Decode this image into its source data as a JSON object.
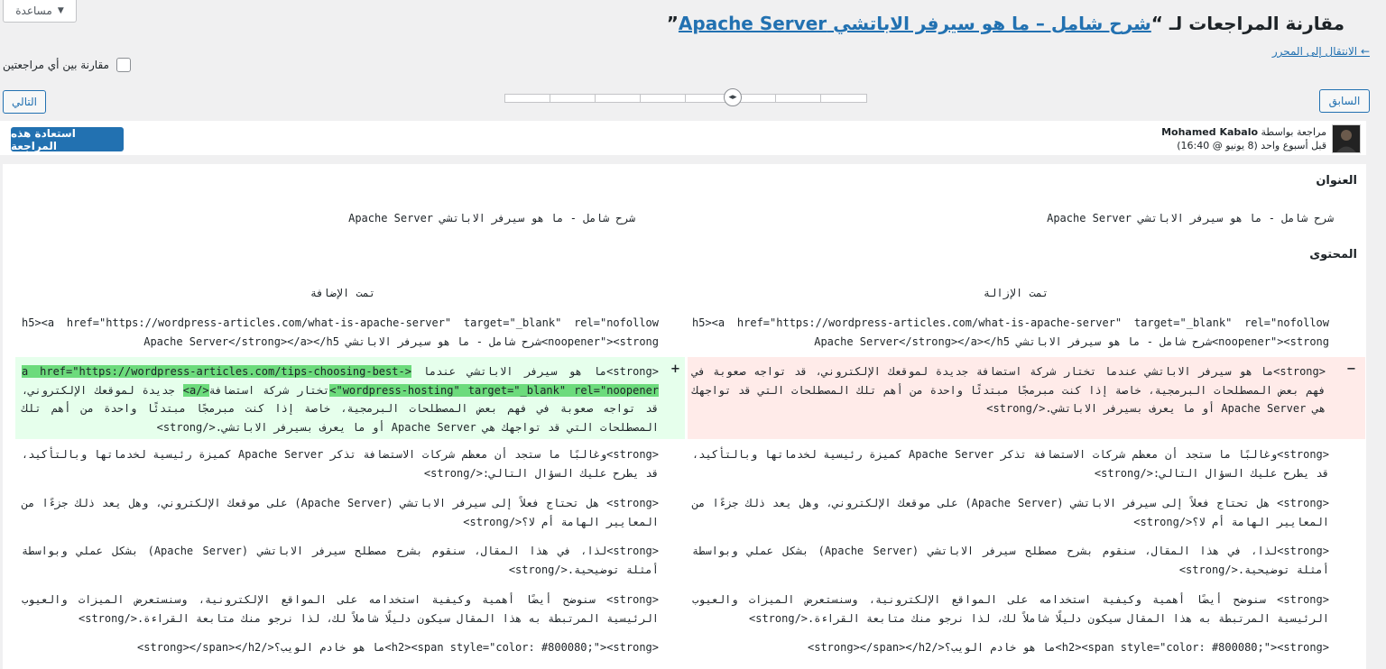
{
  "header": {
    "help_label": "مساعدة",
    "title_prefix": "مقارنة المراجعات لـ “",
    "title_link": "شرح شامل – ما هو سيرفر الاباتشي Apache Server",
    "title_suffix": "”",
    "editor_link": "← الانتقال إلى المحرر",
    "compare_any": "مقارنة بين أي مراجعتين"
  },
  "nav": {
    "next_label": "التالي",
    "prev_label": "السابق"
  },
  "meta": {
    "restore_label": "استعادة هذه المراجعة",
    "revision_by": "مراجعة بواسطة",
    "author": "Mohamed Kabalo",
    "when": "قبل أسبوع واحد (8 يونيو @ 16:40)"
  },
  "diff": {
    "title_label": "العنوان",
    "title_old": "شرح شامل - ما هو سيرفر الاباتشي Apache Server",
    "title_new": "شرح شامل - ما هو سيرفر الاباتشي Apache Server",
    "content_label": "المحتوى",
    "removed_head": "تمت الإزالة",
    "added_head": "تمت الإضافة",
    "rows": [
      {
        "left": "h5><a href=\"https://wordpress-articles.com/what-is-apache-server\" target=\"_blank\" rel=\"nofollow noopener\"><strong>شرح شامل - ما هو سيرفر الاباتشي Apache Server</strong></a></h5",
        "right": "h5><a href=\"https://wordpress-articles.com/what-is-apache-server\" target=\"_blank\" rel=\"nofollow noopener\"><strong>شرح شامل - ما هو سيرفر الاباتشي Apache Server</strong></a></h5"
      },
      {
        "removed_marker": "−",
        "added_marker": "+",
        "left_a": "<strong>ما هو سيرفر الاباتشي عندما ",
        "left_hl1": "<a href=\"https://wordpress-articles.com/tips-choosing-best-wordpress-hosting\" target=\"_blank\" rel=\"noopener\">",
        "left_b": "تختار شركة استضافة",
        "left_hl2": "</a>",
        "left_c": " جديدة لموقعك الإلكتروني، قد تواجه صعوبة في فهم بعض المصطلحات البرمجية، خاصة إذا كنت مبرمجًا مبتدئًا واحدة من أهم تلك المصطلحات التي قد تواجهك هي Apache Server أو ما يعرف بسيرفر الاباتشي.</strong>",
        "right": "<strong>ما هو سيرفر الاباتشي عندما تختار شركة استضافة جديدة لموقعك الإلكتروني، قد تواجه صعوبة في فهم بعض المصطلحات البرمجية، خاصة إذا كنت مبرمجًا مبتدئًا واحدة من أهم تلك المصطلحات التي قد تواجهك هي Apache Server أو ما يعرف بسيرفر الاباتشي.</strong>"
      },
      {
        "left": "<strong>وغالبًا ما ستجد أن معظم شركات الاستضافة تذكر Apache Server كميزة رئيسية لخدماتها وبالتأكيد، قد يطرح عليك السؤال التالي:</strong>",
        "right": "<strong>وغالبًا ما ستجد أن معظم شركات الاستضافة تذكر Apache Server كميزة رئيسية لخدماتها وبالتأكيد، قد يطرح عليك السؤال التالي:</strong>"
      },
      {
        "left": "<strong> هل تحتاج فعلاً إلى سيرفر الاباتشي (Apache Server) على موقعك الإلكتروني، وهل يعد ذلك جزءًا من المعايير الهامة أم لا؟</strong>",
        "right": "<strong> هل تحتاج فعلاً إلى سيرفر الاباتشي (Apache Server) على موقعك الإلكتروني، وهل يعد ذلك جزءًا من المعايير الهامة أم لا؟</strong>"
      },
      {
        "left": "<strong>لذا، في هذا المقال، سنقوم بشرح مصطلح سيرفر الاباتشي (Apache Server) بشكل عملي وبواسطة أمثلة توضيحية.</strong>",
        "right": "<strong>لذا، في هذا المقال، سنقوم بشرح مصطلح سيرفر الاباتشي (Apache Server) بشكل عملي وبواسطة أمثلة توضيحية.</strong>"
      },
      {
        "left": "<strong> سنوضح أيضًا أهمية وكيفية استخدامه على المواقع الإلكترونية، وسنستعرض الميزات والعيوب الرئيسية المرتبطة به هذا المقال سيكون دليلًا شاملاً لك، لذا نرجو منك متابعة القراءة.</strong>",
        "right": "<strong> سنوضح أيضًا أهمية وكيفية استخدامه على المواقع الإلكترونية، وسنستعرض الميزات والعيوب الرئيسية المرتبطة به هذا المقال سيكون دليلًا شاملاً لك، لذا نرجو منك متابعة القراءة.</strong>"
      },
      {
        "left": "<h2><span style=\"color: #800080;\"><strong>ما هو خادم الويب؟</strong></span></h2>",
        "right": "<h2><span style=\"color: #800080;\"><strong>ما هو خادم الويب؟</strong></span></h2>"
      }
    ]
  }
}
